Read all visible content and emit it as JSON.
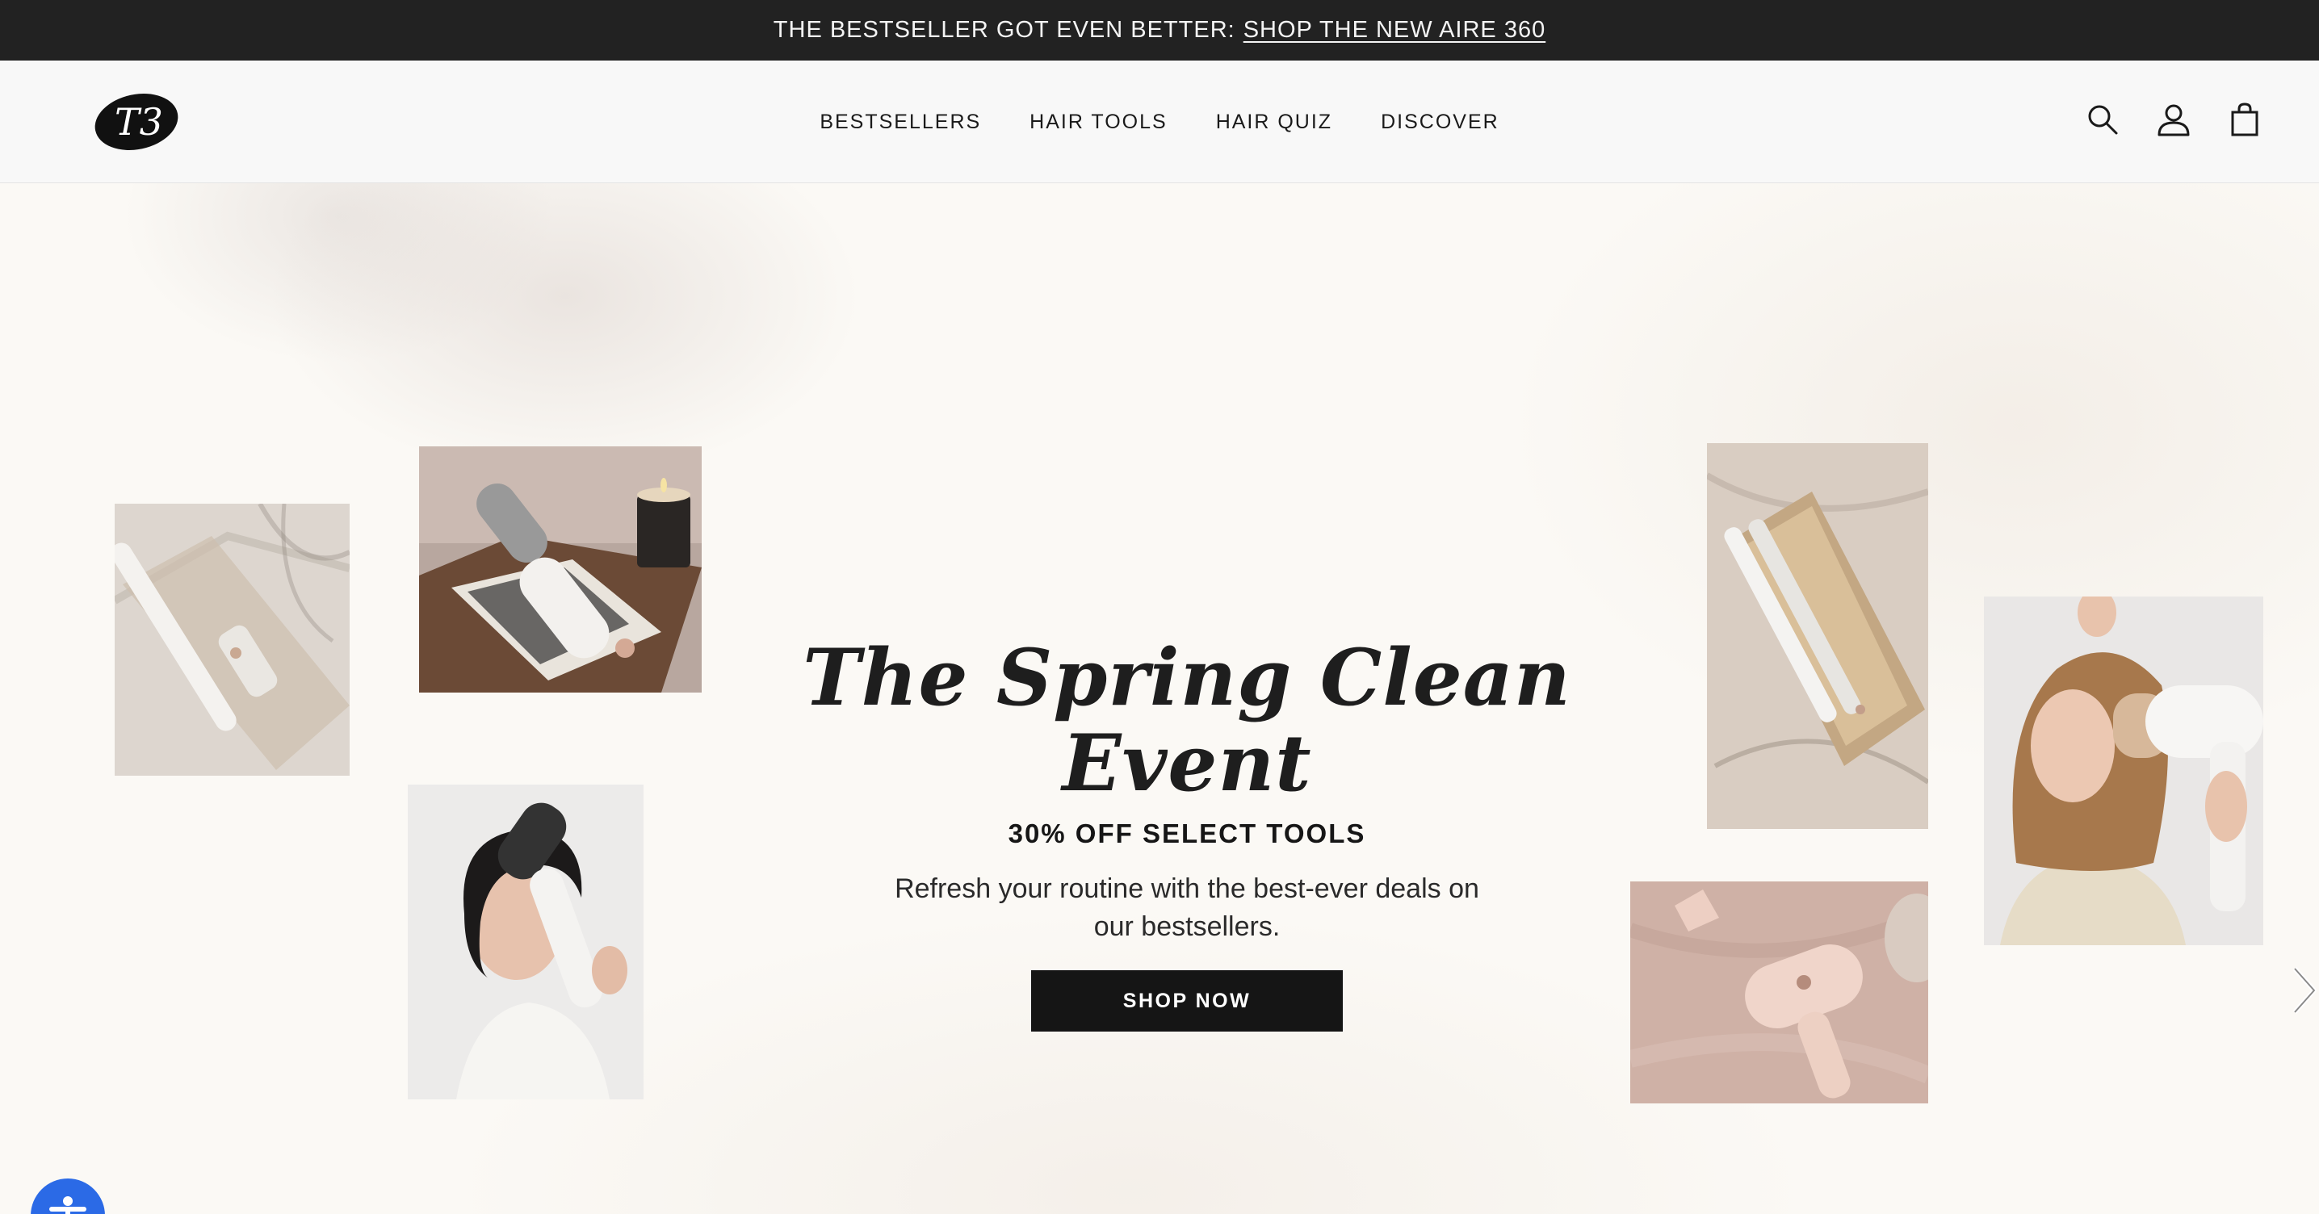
{
  "announcement": {
    "text": "THE BESTSELLER GOT EVEN BETTER:",
    "link": "SHOP THE NEW AIRE 360"
  },
  "header": {
    "logo_text": "T3",
    "nav": [
      "BESTSELLERS",
      "HAIR TOOLS",
      "HAIR QUIZ",
      "DISCOVER"
    ],
    "icons": [
      "search-icon",
      "account-icon",
      "cart-icon"
    ]
  },
  "hero": {
    "title": "The Spring Clean Event",
    "subtitle": "30% OFF SELECT TOOLS",
    "description": "Refresh your routine with the best-ever deals on our bestsellers.",
    "cta_label": "SHOP NOW",
    "photos": [
      "curling-iron-on-tray",
      "brush-dryer-on-books-with-candle",
      "woman-with-round-brush-dryer",
      "flat-iron-in-wooden-tray",
      "pink-hair-dryer-on-satin",
      "woman-with-hair-dryer-and-brush"
    ]
  },
  "colors": {
    "announcement_bg": "#222222",
    "header_bg": "#f8f8f8",
    "cta_bg": "#151515",
    "accessibility_blue": "#2b6ae6"
  }
}
